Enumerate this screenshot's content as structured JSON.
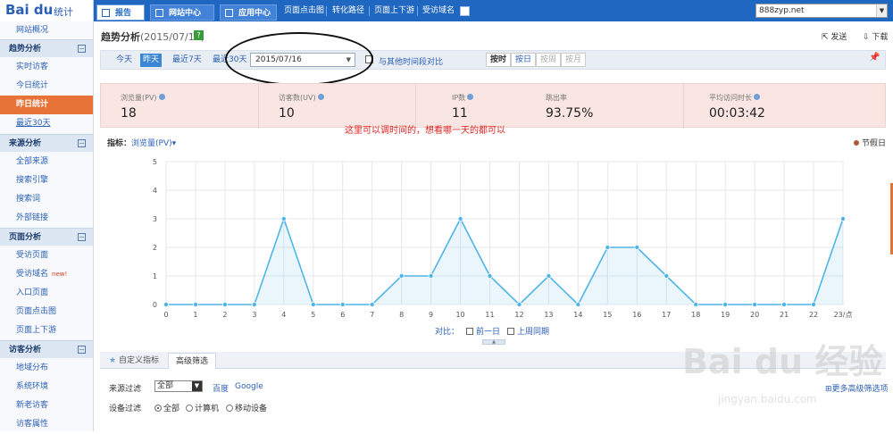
{
  "brand": {
    "logo": "Bai du",
    "sub": "统计"
  },
  "topnav": {
    "tabs": [
      "报告",
      "网站中心",
      "应用中心"
    ],
    "links": [
      "页面点击图",
      "转化路径",
      "页面上下游",
      "受访域名"
    ],
    "site": "888zyp.net"
  },
  "sidebar": {
    "groups": [
      {
        "items": [
          {
            "label": "网站概况"
          }
        ]
      },
      {
        "header": "趋势分析",
        "items": [
          {
            "label": "实时访客"
          },
          {
            "label": "今日统计"
          },
          {
            "label": "昨日统计",
            "active": true
          },
          {
            "label": "最近30天",
            "underline": true
          }
        ]
      },
      {
        "header": "来源分析",
        "items": [
          {
            "label": "全部来源"
          },
          {
            "label": "搜索引擎"
          },
          {
            "label": "搜索词"
          },
          {
            "label": "外部链接"
          }
        ]
      },
      {
        "header": "页面分析",
        "items": [
          {
            "label": "受访页面"
          },
          {
            "label": "受访域名",
            "badge": "new!"
          },
          {
            "label": "入口页面"
          },
          {
            "label": "页面点击图"
          },
          {
            "label": "页面上下游"
          }
        ]
      },
      {
        "header": "访客分析",
        "items": [
          {
            "label": "地域分布"
          },
          {
            "label": "系统环境"
          },
          {
            "label": "新老访客"
          },
          {
            "label": "访客属性"
          }
        ]
      }
    ]
  },
  "page": {
    "title": "趋势分析",
    "title_date": "(2015/07/16)",
    "send": "发送",
    "download": "下载"
  },
  "filter": {
    "ranges": [
      "今天",
      "昨天",
      "最近7天",
      "最近30天"
    ],
    "active_range": "昨天",
    "date": "2015/07/16",
    "compare_label": "与其他时间段对比",
    "granularity": [
      "按时",
      "按日",
      "按周",
      "按月"
    ]
  },
  "stats": [
    {
      "label": "浏览量(PV)",
      "value": "18"
    },
    {
      "label": "访客数(UV)",
      "value": "10"
    },
    {
      "label": "IP数",
      "value": "11"
    },
    {
      "label": "跳出率",
      "value": "93.75%"
    },
    {
      "label": "平均访问时长",
      "value": "00:03:42"
    }
  ],
  "annotation": "这里可以调时间的，想看哪一天的都可以",
  "chart": {
    "metric_label": "指标：",
    "metric": "浏览量(PV)",
    "holiday": "节假日",
    "compare_label": "对比：",
    "compare_options": [
      "前一日",
      "上周同期"
    ]
  },
  "chart_data": {
    "type": "area",
    "x": [
      "0",
      "1",
      "2",
      "3",
      "4",
      "5",
      "6",
      "7",
      "8",
      "9",
      "10",
      "11",
      "12",
      "13",
      "14",
      "15",
      "16",
      "17",
      "18",
      "19",
      "20",
      "21",
      "22",
      "23/点"
    ],
    "series": [
      {
        "values": [
          0,
          0,
          0,
          0,
          3,
          0,
          0,
          0,
          1,
          1,
          3,
          1,
          0,
          1,
          0,
          2,
          2,
          1,
          0,
          0,
          0,
          0,
          0,
          3
        ]
      }
    ],
    "yticks": [
      0,
      1,
      2,
      3,
      4,
      5
    ],
    "ylim": [
      0,
      5
    ],
    "color": "#4fb4e8",
    "grid": true
  },
  "bottom": {
    "tabs": [
      "自定义指标",
      "高级筛选"
    ],
    "source_filter_label": "来源过滤",
    "source_value": "全部",
    "source_links": [
      "百度",
      "Google"
    ],
    "device_filter_label": "设备过滤",
    "devices": [
      "全部",
      "计算机",
      "移动设备"
    ],
    "more": "更多高级筛选项"
  },
  "watermark": {
    "text": "Bai du 经验",
    "url": "jingyan.baidu.com"
  }
}
